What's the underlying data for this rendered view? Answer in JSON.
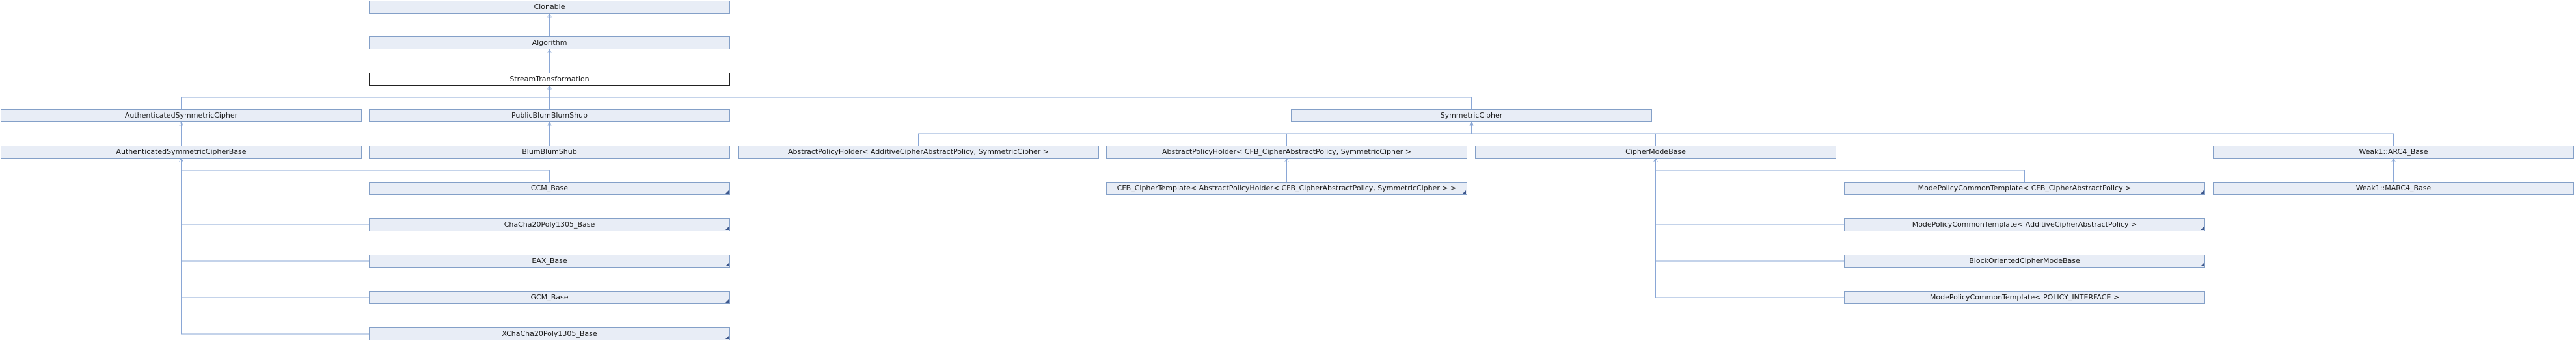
{
  "diagram": {
    "type": "inheritance",
    "colors": {
      "edge": "#8aa7d6",
      "node_fill": "#e8edf6",
      "node_border": "#84a0c8",
      "current_border": "#222222"
    },
    "nodes": [
      {
        "id": "clonable",
        "label": "Clonable"
      },
      {
        "id": "algorithm",
        "label": "Algorithm"
      },
      {
        "id": "stream_transformation",
        "label": "StreamTransformation",
        "current": true
      },
      {
        "id": "authenticated_symmetric_cipher",
        "label": "AuthenticatedSymmetricCipher"
      },
      {
        "id": "public_blum_blum_shub",
        "label": "PublicBlumBlumShub"
      },
      {
        "id": "symmetric_cipher",
        "label": "SymmetricCipher"
      },
      {
        "id": "authenticated_symmetric_cipher_base",
        "label": "AuthenticatedSymmetricCipherBase"
      },
      {
        "id": "blum_blum_shub",
        "label": "BlumBlumShub"
      },
      {
        "id": "abstract_policy_holder_additive",
        "label": "AbstractPolicyHolder< AdditiveCipherAbstractPolicy, SymmetricCipher >"
      },
      {
        "id": "abstract_policy_holder_cfb",
        "label": "AbstractPolicyHolder< CFB_CipherAbstractPolicy, SymmetricCipher >"
      },
      {
        "id": "cipher_mode_base",
        "label": "CipherModeBase"
      },
      {
        "id": "weak1_arc4_base",
        "label": "Weak1::ARC4_Base"
      },
      {
        "id": "ccm_base",
        "label": "CCM_Base",
        "more": true
      },
      {
        "id": "cfb_cipher_template",
        "label": "CFB_CipherTemplate< AbstractPolicyHolder< CFB_CipherAbstractPolicy, SymmetricCipher > >",
        "more": true
      },
      {
        "id": "mode_policy_cfb",
        "label": "ModePolicyCommonTemplate< CFB_CipherAbstractPolicy >",
        "more": true
      },
      {
        "id": "weak1_marc4_base",
        "label": "Weak1::MARC4_Base"
      },
      {
        "id": "chacha20poly1305_base",
        "label": "ChaCha20Poly1305_Base",
        "more": true
      },
      {
        "id": "mode_policy_additive",
        "label": "ModePolicyCommonTemplate< AdditiveCipherAbstractPolicy >",
        "more": true
      },
      {
        "id": "eax_base",
        "label": "EAX_Base",
        "more": true
      },
      {
        "id": "block_oriented_cipher_mode_base",
        "label": "BlockOrientedCipherModeBase",
        "more": true
      },
      {
        "id": "gcm_base",
        "label": "GCM_Base",
        "more": true
      },
      {
        "id": "mode_policy_policy_interface",
        "label": "ModePolicyCommonTemplate< POLICY_INTERFACE >"
      },
      {
        "id": "xchacha20poly1305_base",
        "label": "XChaCha20Poly1305_Base",
        "more": true
      }
    ],
    "edges": [
      {
        "from": "algorithm",
        "to": "clonable"
      },
      {
        "from": "stream_transformation",
        "to": "algorithm"
      },
      {
        "from": "authenticated_symmetric_cipher",
        "to": "stream_transformation"
      },
      {
        "from": "public_blum_blum_shub",
        "to": "stream_transformation"
      },
      {
        "from": "symmetric_cipher",
        "to": "stream_transformation"
      },
      {
        "from": "authenticated_symmetric_cipher_base",
        "to": "authenticated_symmetric_cipher"
      },
      {
        "from": "blum_blum_shub",
        "to": "public_blum_blum_shub"
      },
      {
        "from": "abstract_policy_holder_additive",
        "to": "symmetric_cipher"
      },
      {
        "from": "abstract_policy_holder_cfb",
        "to": "symmetric_cipher"
      },
      {
        "from": "cipher_mode_base",
        "to": "symmetric_cipher"
      },
      {
        "from": "weak1_arc4_base",
        "to": "symmetric_cipher"
      },
      {
        "from": "ccm_base",
        "to": "authenticated_symmetric_cipher_base"
      },
      {
        "from": "chacha20poly1305_base",
        "to": "authenticated_symmetric_cipher_base"
      },
      {
        "from": "eax_base",
        "to": "authenticated_symmetric_cipher_base"
      },
      {
        "from": "gcm_base",
        "to": "authenticated_symmetric_cipher_base"
      },
      {
        "from": "xchacha20poly1305_base",
        "to": "authenticated_symmetric_cipher_base"
      },
      {
        "from": "cfb_cipher_template",
        "to": "abstract_policy_holder_cfb"
      },
      {
        "from": "mode_policy_cfb",
        "to": "cipher_mode_base"
      },
      {
        "from": "mode_policy_additive",
        "to": "cipher_mode_base"
      },
      {
        "from": "block_oriented_cipher_mode_base",
        "to": "cipher_mode_base"
      },
      {
        "from": "mode_policy_policy_interface",
        "to": "cipher_mode_base"
      },
      {
        "from": "weak1_marc4_base",
        "to": "weak1_arc4_base"
      }
    ]
  }
}
